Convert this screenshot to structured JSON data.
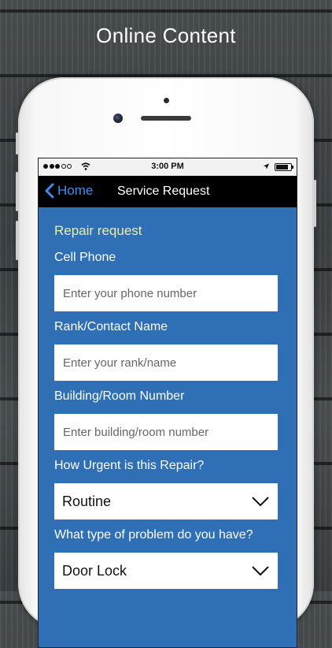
{
  "headline": "Online Content",
  "status_bar": {
    "time": "3:00 PM"
  },
  "nav": {
    "back_label": "Home",
    "title": "Service Request"
  },
  "form": {
    "section_title": "Repair request",
    "fields": [
      {
        "label": "Cell Phone",
        "placeholder": "Enter your phone number"
      },
      {
        "label": "Rank/Contact Name",
        "placeholder": "Enter your rank/name"
      },
      {
        "label": "Building/Room Number",
        "placeholder": "Enter building/room number"
      }
    ],
    "selects": [
      {
        "label": "How Urgent is this Repair?",
        "value": "Routine"
      },
      {
        "label": "What type of problem do you have?",
        "value": "Door Lock"
      }
    ]
  },
  "colors": {
    "screen_bg": "#2e6fb6",
    "nav_bg": "#000000",
    "accent": "#3d8ef0",
    "section_title": "#e8efa0"
  }
}
